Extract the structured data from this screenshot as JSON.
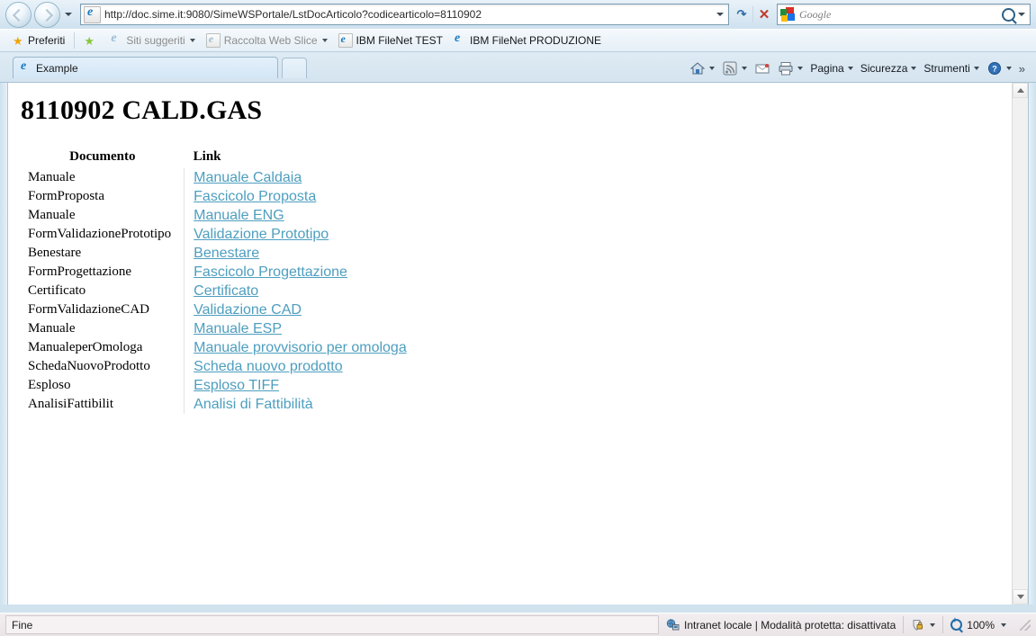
{
  "browser": {
    "address": {
      "url": "http://doc.sime.it:9080/SimeWSPortale/LstDocArticolo?codicearticolo=8110902",
      "url_prefix": "http://doc.",
      "url_domain": "sime.it",
      "url_suffix": ":9080/SimeWSPortale/LstDocArticolo?codicearticolo=8110902",
      "icon": "ie-page-icon",
      "dropdown_icon": "chevron-down-icon",
      "refresh_icon": "refresh-icon",
      "stop_icon": "stop-icon"
    },
    "search": {
      "provider": "Google",
      "placeholder": "Google",
      "value": "",
      "icon": "google-logo-icon",
      "search_icon": "search-icon",
      "dropdown_icon": "chevron-down-icon"
    },
    "back_button_label": "Indietro",
    "forward_button_label": "Avanti",
    "favorites_bar": {
      "button_label": "Preferiti",
      "items": [
        {
          "label": "Siti suggeriti",
          "icon": "ie-icon",
          "has_caret": true,
          "muted": true
        },
        {
          "label": "Raccolta Web Slice",
          "icon": "ie-icon",
          "has_caret": true,
          "muted": true
        },
        {
          "label": "IBM FileNet TEST",
          "icon": "ie-icon",
          "has_caret": false,
          "muted": false
        },
        {
          "label": "IBM FileNet PRODUZIONE",
          "icon": "ie-icon",
          "has_caret": false,
          "muted": false
        }
      ]
    },
    "tabs": [
      {
        "label": "Example",
        "icon": "ie-icon",
        "active": true
      }
    ],
    "new_tab_label": "",
    "command_bar": {
      "icons": [
        {
          "name": "home-icon",
          "has_caret": true
        },
        {
          "name": "feeds-rss-icon",
          "has_caret": true
        },
        {
          "name": "mail-icon",
          "has_caret": false
        },
        {
          "name": "print-icon",
          "has_caret": true
        }
      ],
      "menus": [
        {
          "label": "Pagina"
        },
        {
          "label": "Sicurezza"
        },
        {
          "label": "Strumenti"
        }
      ],
      "help_icon": "help-icon",
      "overflow_label": "»"
    },
    "status_bar": {
      "status_text": "Fine",
      "zone_text": "Intranet locale | Modalità protetta: disattivata",
      "zone_icon": "intranet-zone-icon",
      "protected_icon": "protected-mode-icon",
      "zoom_level": "100%",
      "zoom_icon": "zoom-icon"
    },
    "scrollbar": {
      "up_icon": "triangle-up-icon",
      "down_icon": "triangle-down-icon"
    }
  },
  "page": {
    "title": "8110902 CALD.GAS",
    "table": {
      "headers": {
        "documento": "Documento",
        "link": "Link"
      },
      "rows": [
        {
          "documento": "Manuale",
          "link": "Manuale Caldaia",
          "underlined": true
        },
        {
          "documento": "FormProposta",
          "link": "Fascicolo Proposta",
          "underlined": true
        },
        {
          "documento": "Manuale",
          "link": "Manuale ENG",
          "underlined": true
        },
        {
          "documento": "FormValidazionePrototipo",
          "link": "Validazione Prototipo",
          "underlined": true
        },
        {
          "documento": "Benestare",
          "link": "Benestare",
          "underlined": true
        },
        {
          "documento": "FormProgettazione",
          "link": "Fascicolo Progettazione",
          "underlined": true
        },
        {
          "documento": "Certificato",
          "link": "Certificato",
          "underlined": true
        },
        {
          "documento": "FormValidazioneCAD",
          "link": "Validazione CAD",
          "underlined": true
        },
        {
          "documento": "Manuale",
          "link": "Manuale ESP",
          "underlined": true
        },
        {
          "documento": "ManualeperOmologa",
          "link": "Manuale provvisorio per omologa",
          "underlined": true
        },
        {
          "documento": "SchedaNuovoProdotto",
          "link": "Scheda nuovo prodotto",
          "underlined": true
        },
        {
          "documento": "Esploso",
          "link": "Esploso TIFF",
          "underlined": true
        },
        {
          "documento": "AnalisiFattibilit",
          "link": "Analisi di Fattibilità",
          "underlined": false
        }
      ]
    }
  },
  "colors": {
    "link": "#4d9ebf",
    "chrome_top": "#dceaf4",
    "status_bg": "#efe9ec"
  }
}
